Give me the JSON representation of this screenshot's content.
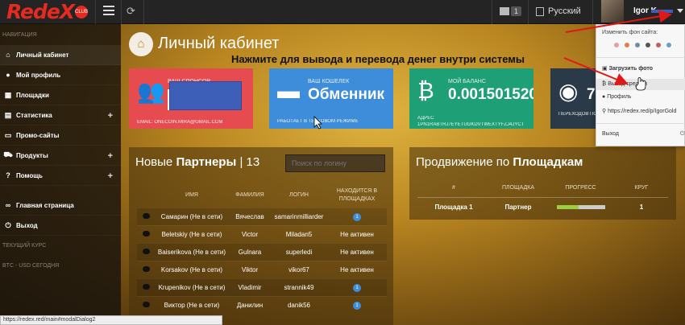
{
  "brand": {
    "name": "RedeX",
    "badge": "CLUB"
  },
  "topbar": {
    "notifications_count": "1",
    "language": "Русский",
    "user_name": "Igor K"
  },
  "sidebar": {
    "heading": "НАВИГАЦИЯ",
    "items": [
      {
        "label": "Личный кабинет",
        "icon": "home-icon",
        "active": true
      },
      {
        "label": "Мой профиль",
        "icon": "user-icon"
      },
      {
        "label": "Площадки",
        "icon": "table-icon"
      },
      {
        "label": "Статистика",
        "icon": "chart-icon",
        "expandable": true
      },
      {
        "label": "Промо-сайты",
        "icon": "monitor-icon"
      },
      {
        "label": "Продукты",
        "icon": "cart-icon",
        "expandable": true
      },
      {
        "label": "Помощь",
        "icon": "question-icon",
        "expandable": true
      }
    ],
    "items2": [
      {
        "label": "Главная страница",
        "icon": "link-icon"
      },
      {
        "label": "Выход",
        "icon": "power-icon"
      }
    ],
    "current_rate": "ТЕКУЩИЙ КУРС",
    "btc_today": "BTC - USD СЕГОДНЯ"
  },
  "page": {
    "title": "Личный кабинет"
  },
  "annotation": "Нажмите для вывода и перевода денег внутри системы",
  "cards": {
    "sponsor": {
      "label": "ВАШ СПОНСОР",
      "sub": "EMAIL: ONECOIN.MIRA@GMAIL.COM",
      "color": "#e64b50"
    },
    "wallet": {
      "label": "ВАШ КОШЕЛЕК",
      "value": "Обменник",
      "sub": "РАБОТАЕТ В ТЕСТОВОМ РЕЖИМЕ",
      "color": "#3d8ddb"
    },
    "balance": {
      "label": "МОЙ БАЛАНС",
      "value": "0.001501520",
      "sub1": "АДРЕС",
      "sub2": "1PN1RABTRJ7EYETUGKDVTWEXTYFZJ4JYCT",
      "color": "#1e9f75"
    },
    "referrals": {
      "value": "7",
      "sub": "ПЕРЕХОДОВ ПО",
      "color": "#2a3a48"
    }
  },
  "partners": {
    "title_pre": "Новые",
    "title_bold": "Партнеры",
    "title_count": "| 13",
    "search_placeholder": "Поиск по логину",
    "columns": [
      "",
      "ИМЯ",
      "ФАМИЛИЯ",
      "ЛОГИН",
      "НАХОДИТСЯ В ПЛОЩАДКАХ"
    ],
    "rows": [
      {
        "name": "Самарин (Не в сети)",
        "surname": "Вячеслав",
        "login": "samarinmilliarder",
        "status": "1",
        "badge": true
      },
      {
        "name": "Beletskiy (Не в сети)",
        "surname": "Victor",
        "login": "Miladan5",
        "status": "Не активен",
        "badge": false
      },
      {
        "name": "Baiserikova (Не в сети)",
        "surname": "Gulnara",
        "login": "superledi",
        "status": "Не активен",
        "badge": false
      },
      {
        "name": "Korsakov (Не в сети)",
        "surname": "Viktor",
        "login": "vikor67",
        "status": "Не активен",
        "badge": false
      },
      {
        "name": "Krupenikov (Не в сети)",
        "surname": "Vladimir",
        "login": "strannik49",
        "status": "1",
        "badge": true
      },
      {
        "name": "Виктор (Не в сети)",
        "surname": "Данилин",
        "login": "danik56",
        "status": "1",
        "badge": true
      }
    ]
  },
  "promotion": {
    "title_pre": "Продвижение по",
    "title_bold": "Площадкам",
    "columns": [
      "#",
      "ПЛОЩАДКА",
      "ПРОГРЕСС",
      "КРУГ"
    ],
    "rows": [
      {
        "num": "Площадка 1",
        "place": "Партнер",
        "progress": 0.45,
        "round": "1"
      }
    ]
  },
  "dropdown": {
    "caption": "Изменить фон сайта:",
    "swatches": [
      "#e3a0a0",
      "#e0804c",
      "#7788aa",
      "#555555",
      "#c06060",
      "#6aa0c8"
    ],
    "upload": "Загрузить фото",
    "withdraw": "Вывод средств",
    "profile": "Профиль",
    "link": "https://redex.red/p/IgorGold",
    "logout": "Выход"
  },
  "statusbar": "https://redex.red/main#modalDialog2"
}
